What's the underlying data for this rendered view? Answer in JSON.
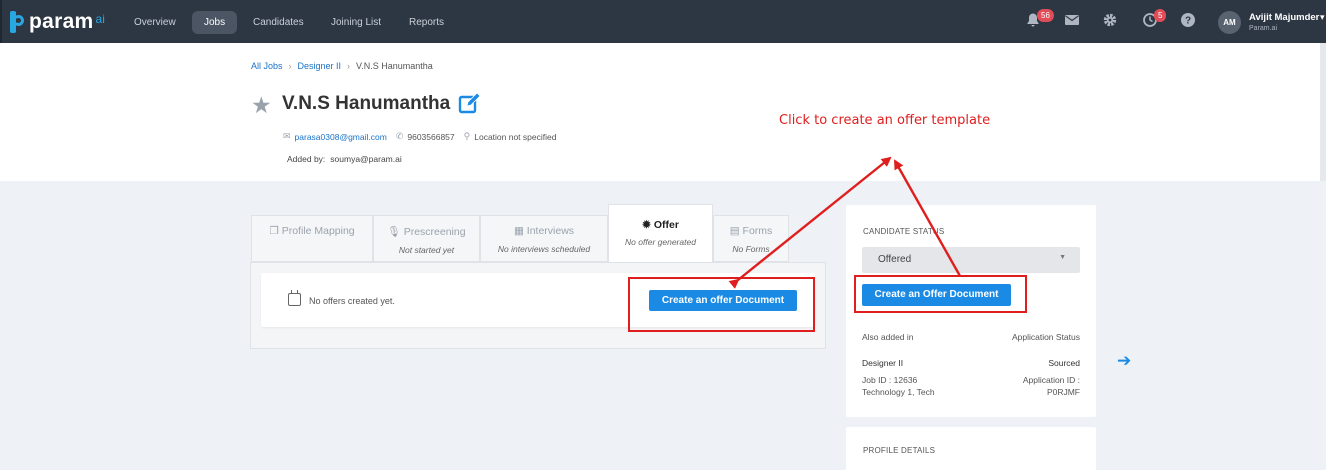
{
  "brand": {
    "name": "param",
    "suffix": "ai"
  },
  "nav": {
    "items": [
      "Overview",
      "Jobs",
      "Candidates",
      "Joining List",
      "Reports"
    ],
    "active": "Jobs",
    "notifications_count": "56",
    "timer_count": "5"
  },
  "user": {
    "initials": "AM",
    "name": "Avijit Majumder",
    "org": "Param.ai"
  },
  "breadcrumb": {
    "root": "All Jobs",
    "job": "Designer II",
    "current": "V.N.S Hanumantha"
  },
  "candidate": {
    "name": "V.N.S Hanumantha",
    "email": "parasa0308@gmail.com",
    "phone": "9603566857",
    "location": "Location not specified",
    "added_by_label": "Added by:",
    "added_by": "soumya@param.ai"
  },
  "annotation": {
    "callout": "Click to create an offer template",
    "color": "#e01e1e"
  },
  "tabs": [
    {
      "label": "Profile Mapping",
      "sub": "",
      "icon": "copy-icon"
    },
    {
      "label": "Prescreening",
      "sub": "Not started yet",
      "icon": "mic-icon"
    },
    {
      "label": "Interviews",
      "sub": "No interviews scheduled",
      "icon": "calendar-icon"
    },
    {
      "label": "Offer",
      "sub": "No offer generated",
      "icon": "badge-icon",
      "active": true
    },
    {
      "label": "Forms",
      "sub": "No Forms",
      "icon": "document-icon"
    }
  ],
  "offer_panel": {
    "empty_text": "No offers created yet.",
    "create_button": "Create an offer Document"
  },
  "side": {
    "status_title": "CANDIDATE STATUS",
    "status_value": "Offered",
    "create_button": "Create an Offer Document",
    "also_added_label": "Also added in",
    "app_status_label": "Application Status",
    "job_title": "Designer II",
    "app_status": "Sourced",
    "job_id": "Job ID : 12636",
    "app_id_label": "Application ID :",
    "department": "Technology 1, Tech",
    "app_id": "P0RJMF",
    "profile_title": "PROFILE DETAILS"
  },
  "colors": {
    "accent": "#1a8ae5",
    "nav_bg": "#2d3643",
    "badge": "#e04c57"
  }
}
